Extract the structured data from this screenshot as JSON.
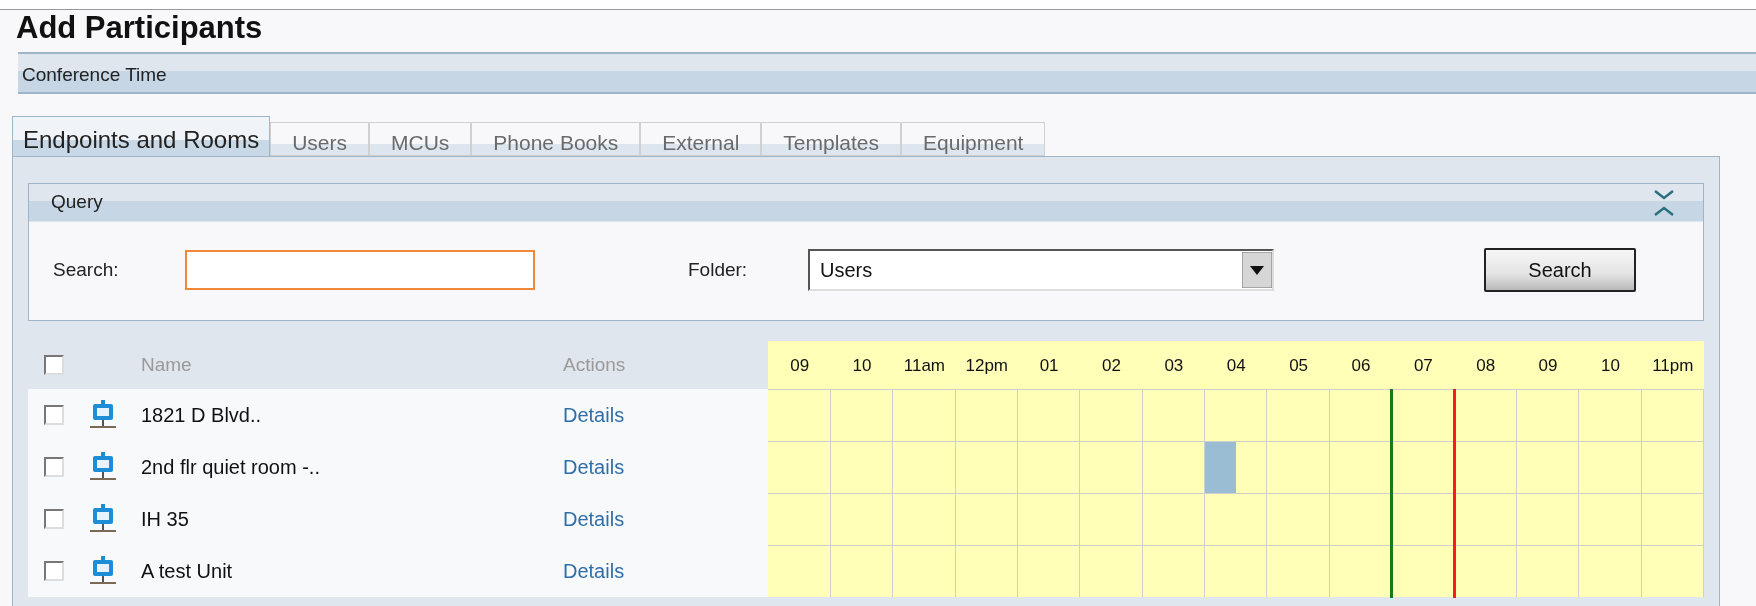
{
  "page_title": "Add Participants",
  "section_bar": {
    "label": "Conference Time"
  },
  "tabs": [
    {
      "label": "Endpoints and Rooms",
      "selected": true
    },
    {
      "label": "Users",
      "selected": false
    },
    {
      "label": "MCUs",
      "selected": false
    },
    {
      "label": "Phone Books",
      "selected": false
    },
    {
      "label": "External",
      "selected": false
    },
    {
      "label": "Templates",
      "selected": false
    },
    {
      "label": "Equipment",
      "selected": false
    }
  ],
  "query": {
    "title": "Query",
    "expanded": true,
    "search_label": "Search:",
    "search_focused": true,
    "folder_label": "Folder:",
    "folder_value": "Users",
    "search_button": "Search"
  },
  "table": {
    "select_all_checked": false,
    "columns": [
      "Name",
      "Actions"
    ],
    "rows": [
      {
        "name": "1821 D Blvd..",
        "action": "Details",
        "checked": false,
        "busy": [
          false,
          false,
          false,
          false,
          false,
          false,
          false,
          false,
          false,
          false,
          false,
          false,
          false,
          false,
          false
        ]
      },
      {
        "name": "2nd flr quiet room -..",
        "action": "Details",
        "checked": false,
        "busy": [
          false,
          false,
          false,
          false,
          false,
          false,
          false,
          true,
          false,
          false,
          false,
          false,
          false,
          false,
          false
        ]
      },
      {
        "name": "IH 35",
        "action": "Details",
        "checked": false,
        "busy": [
          false,
          false,
          false,
          false,
          false,
          false,
          false,
          false,
          false,
          false,
          false,
          false,
          false,
          false,
          false
        ]
      },
      {
        "name": "A test Unit",
        "action": "Details",
        "checked": false,
        "busy": [
          false,
          false,
          false,
          false,
          false,
          false,
          false,
          false,
          false,
          false,
          false,
          false,
          false,
          false,
          false
        ]
      }
    ]
  },
  "timeline": {
    "hours": [
      {
        "label": "09"
      },
      {
        "label": "10"
      },
      {
        "label": "11am"
      },
      {
        "label": "12pm"
      },
      {
        "label": "01"
      },
      {
        "label": "02"
      },
      {
        "label": "03"
      },
      {
        "label": "04"
      },
      {
        "label": "05"
      },
      {
        "label": "06"
      },
      {
        "label": "07",
        "marker": {
          "color": "#1a7a1a"
        }
      },
      {
        "label": "08",
        "marker": {
          "color": "#ff1a1a"
        }
      },
      {
        "label": "09"
      },
      {
        "label": "10"
      },
      {
        "label": "11pm"
      }
    ]
  }
}
